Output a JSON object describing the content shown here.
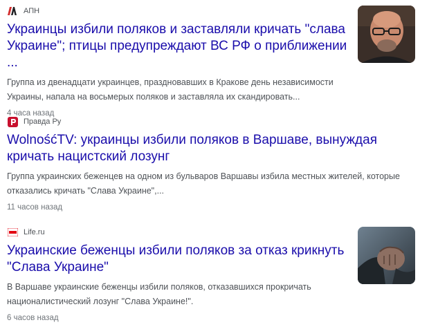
{
  "results": [
    {
      "source": "АПН",
      "source_icon": "apn-logo-icon",
      "headline": "Украинцы избили поляков и заставляли кричать \"слава Украине\"; птицы предупреждают ВС РФ о приближении ...",
      "snippet": "Группа из двенадцати украинцев, праздновавших в Кракове день независимости Украины, напала на восьмерых поляков и заставляла их скандировать...",
      "time": "4 часа назад",
      "thumbnail": "bald-man-glasses-photo"
    },
    {
      "source": "Правда Ру",
      "source_icon": "pravda-ru-logo-icon",
      "headline": "WolnośćTV: украинцы избили поляков в Варшаве, вынуждая кричать нацистский лозунг",
      "snippet": "Группа украинских беженцев на одном из бульваров Варшавы избила местных жителей, которые отказались кричать \"Слава Украине\",...",
      "time": "11 часов назад"
    },
    {
      "source": "Life.ru",
      "source_icon": "life-ru-logo-icon",
      "headline": "Украинские беженцы избили поляков за отказ крикнуть \"Слава Украине\"",
      "snippet": "В Варшаве украинские беженцы избили поляков, отказавшихся прокричать националистический лозунг \"Слава Украине!\".",
      "time": "6 часов назад",
      "thumbnail": "clenched-fist-photo"
    }
  ],
  "colors": {
    "headline": "#1a0dab",
    "snippet": "#4d5156",
    "meta": "#70757a",
    "pravda_red": "#c8102e",
    "life_red": "#e30613"
  }
}
